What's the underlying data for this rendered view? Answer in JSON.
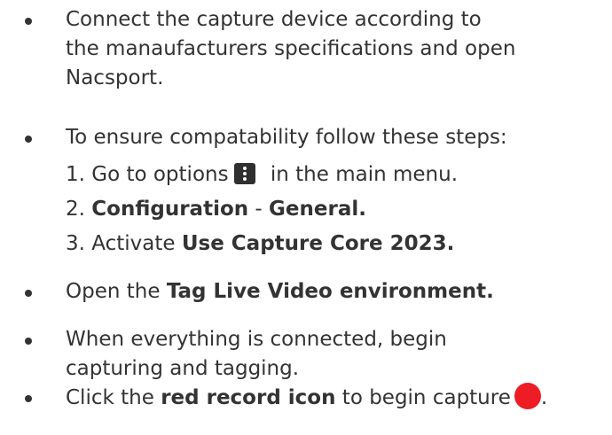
{
  "items": [
    {
      "line1": "Connect the capture device according to",
      "line2": "the manaufacturers specifications and open",
      "line3": "Nacsport."
    },
    {
      "text": "To ensure compatability follow these steps:",
      "steps": [
        {
          "prefix": "1. Go to options",
          "suffix": " in the main menu.",
          "icon": "options-kebab-icon"
        },
        {
          "prefix": "2. ",
          "bold1": "Configuration",
          "middle": " - ",
          "bold2": "General."
        },
        {
          "prefix": "3. Activate ",
          "bold": "Use Capture Core 2023."
        }
      ]
    },
    {
      "prefix": "Open the ",
      "bold": "Tag Live Video environment."
    },
    {
      "line1": "When everything is connected, begin",
      "line2": "capturing and tagging."
    },
    {
      "prefix": "Click the ",
      "bold": "red record icon",
      "suffix": " to begin capture",
      "end": ".",
      "icon": "record-icon"
    }
  ],
  "colors": {
    "text": "#333333",
    "record": "#ee1c25",
    "options_icon_bg": "#2f2f2f"
  }
}
